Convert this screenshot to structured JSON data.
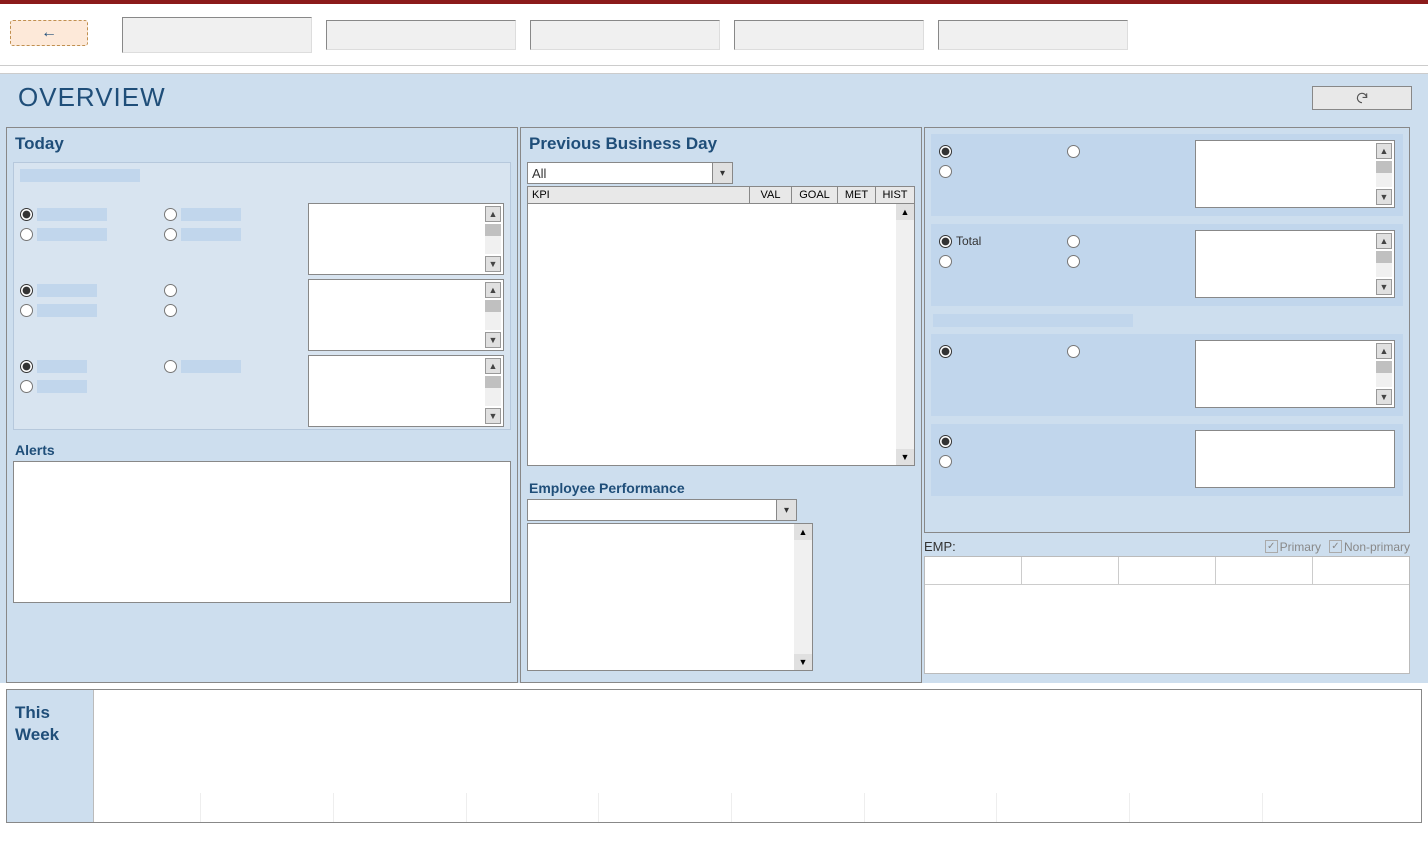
{
  "ribbon": {
    "back_icon": "←"
  },
  "title": "OVERVIEW",
  "today": {
    "title": "Today"
  },
  "alerts": {
    "title": "Alerts"
  },
  "pbd": {
    "title": "Previous Business Day",
    "filter_value": "All",
    "columns": {
      "kpi": "KPI",
      "val": "VAL",
      "goal": "GOAL",
      "met": "MET",
      "hist": "HIST"
    }
  },
  "emp_perf": {
    "title": "Employee Performance",
    "emp_label": "EMP:",
    "primary_label": "Primary",
    "nonprimary_label": "Non-primary"
  },
  "right_groups": {
    "g2_label": "Total"
  },
  "this_week": {
    "title": "This Week"
  }
}
